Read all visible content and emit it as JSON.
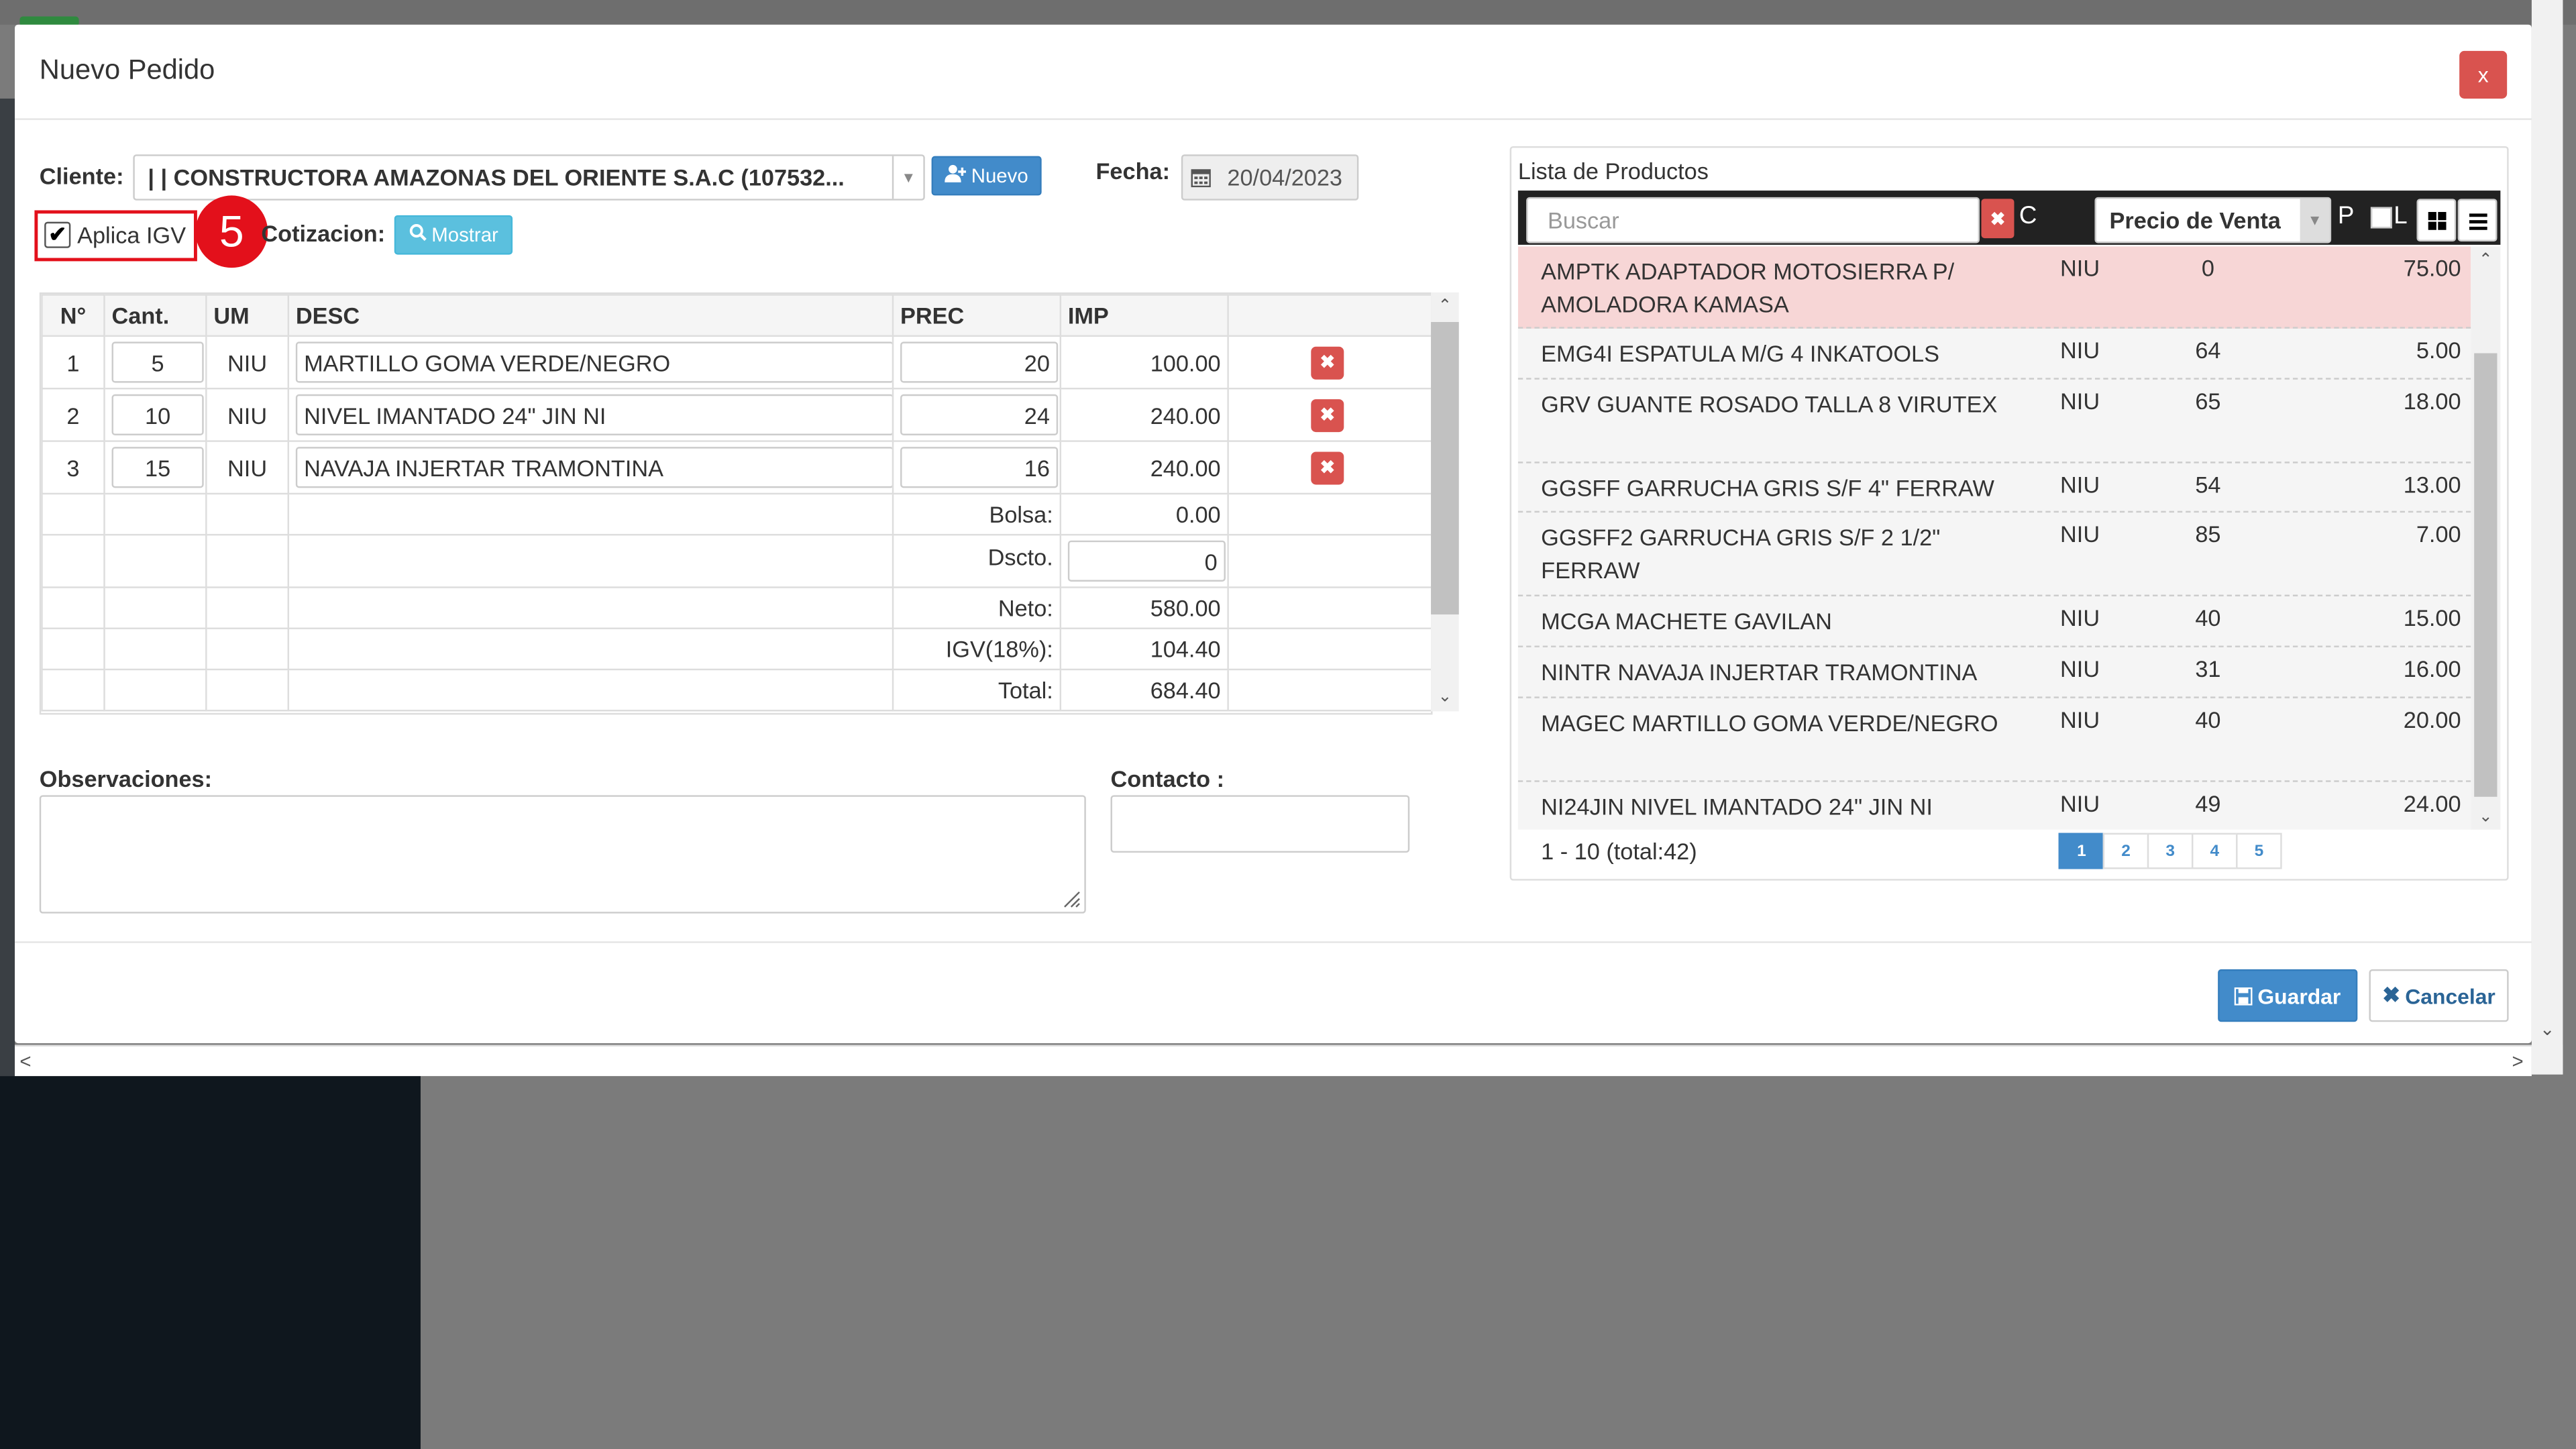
{
  "modal": {
    "title": "Nuevo Pedido",
    "close_label": "x"
  },
  "form": {
    "cliente_label": "Cliente:",
    "cliente_value": "| | CONSTRUCTORA AMAZONAS DEL ORIENTE S.A.C (107532...",
    "nuevo_label": "Nuevo",
    "fecha_label": "Fecha:",
    "fecha_value": "20/04/2023",
    "aplica_igv_label": "Aplica IGV",
    "aplica_igv_checked": true,
    "cotizacion_label": "Cotizacion:",
    "mostrar_label": "Mostrar",
    "annotation_badge": "5"
  },
  "order_table": {
    "headers": [
      "N°",
      "Cant.",
      "UM",
      "DESC",
      "PREC",
      "IMP",
      ""
    ],
    "items": [
      {
        "n": "1",
        "cant": "5",
        "um": "NIU",
        "desc": "MARTILLO GOMA VERDE/NEGRO",
        "prec": "20",
        "imp": "100.00"
      },
      {
        "n": "2",
        "cant": "10",
        "um": "NIU",
        "desc": "NIVEL IMANTADO 24\" JIN NI",
        "prec": "24",
        "imp": "240.00"
      },
      {
        "n": "3",
        "cant": "15",
        "um": "NIU",
        "desc": "NAVAJA INJERTAR TRAMONTINA",
        "prec": "16",
        "imp": "240.00"
      }
    ],
    "summary": {
      "bolsa_label": "Bolsa:",
      "bolsa": "0.00",
      "dscto_label": "Dscto.",
      "dscto": "0",
      "neto_label": "Neto:",
      "neto": "580.00",
      "igv_label": "IGV(18%):",
      "igv": "104.40",
      "total_label": "Total:",
      "total": "684.40"
    }
  },
  "observaciones_label": "Observaciones:",
  "contacto_label": "Contacto :",
  "products": {
    "title": "Lista de Productos",
    "search_placeholder": "Buscar",
    "clear_label": "C",
    "price_type": "Precio de Venta",
    "p_label": "P",
    "l_label": "L",
    "rows": [
      {
        "desc": "AMPTK ADAPTADOR MOTOSIERRA P/ AMOLADORA KAMASA",
        "um": "NIU",
        "stock": "0",
        "price": "75.00",
        "highlight": true
      },
      {
        "desc": "EMG4I ESPATULA M/G 4 INKATOOLS",
        "um": "NIU",
        "stock": "64",
        "price": "5.00",
        "highlight": false
      },
      {
        "desc": "GRV GUANTE ROSADO TALLA 8 VIRUTEX",
        "um": "NIU",
        "stock": "65",
        "price": "18.00",
        "highlight": false
      },
      {
        "desc": "GGSFF GARRUCHA GRIS S/F 4\" FERRAW",
        "um": "NIU",
        "stock": "54",
        "price": "13.00",
        "highlight": false
      },
      {
        "desc": "GGSFF2 GARRUCHA GRIS S/F 2 1/2\" FERRAW",
        "um": "NIU",
        "stock": "85",
        "price": "7.00",
        "highlight": false
      },
      {
        "desc": "MCGA MACHETE GAVILAN",
        "um": "NIU",
        "stock": "40",
        "price": "15.00",
        "highlight": false
      },
      {
        "desc": "NINTR NAVAJA INJERTAR TRAMONTINA",
        "um": "NIU",
        "stock": "31",
        "price": "16.00",
        "highlight": false
      },
      {
        "desc": "MAGEC MARTILLO GOMA VERDE/NEGRO",
        "um": "NIU",
        "stock": "40",
        "price": "20.00",
        "highlight": false
      },
      {
        "desc": "NI24JIN NIVEL IMANTADO 24\" JIN NI",
        "um": "NIU",
        "stock": "49",
        "price": "24.00",
        "highlight": false
      }
    ],
    "pager_info": "1 - 10 (total:42)",
    "pages": [
      "1",
      "2",
      "3",
      "4",
      "5"
    ],
    "active_page": "1"
  },
  "footer": {
    "guardar_label": "Guardar",
    "cancelar_label": "Cancelar"
  },
  "colors": {
    "primary": "#428bca",
    "danger": "#d9534f",
    "info": "#5bc0de",
    "highlight_row": "#f7d6d6",
    "annotation": "#e3101b"
  }
}
